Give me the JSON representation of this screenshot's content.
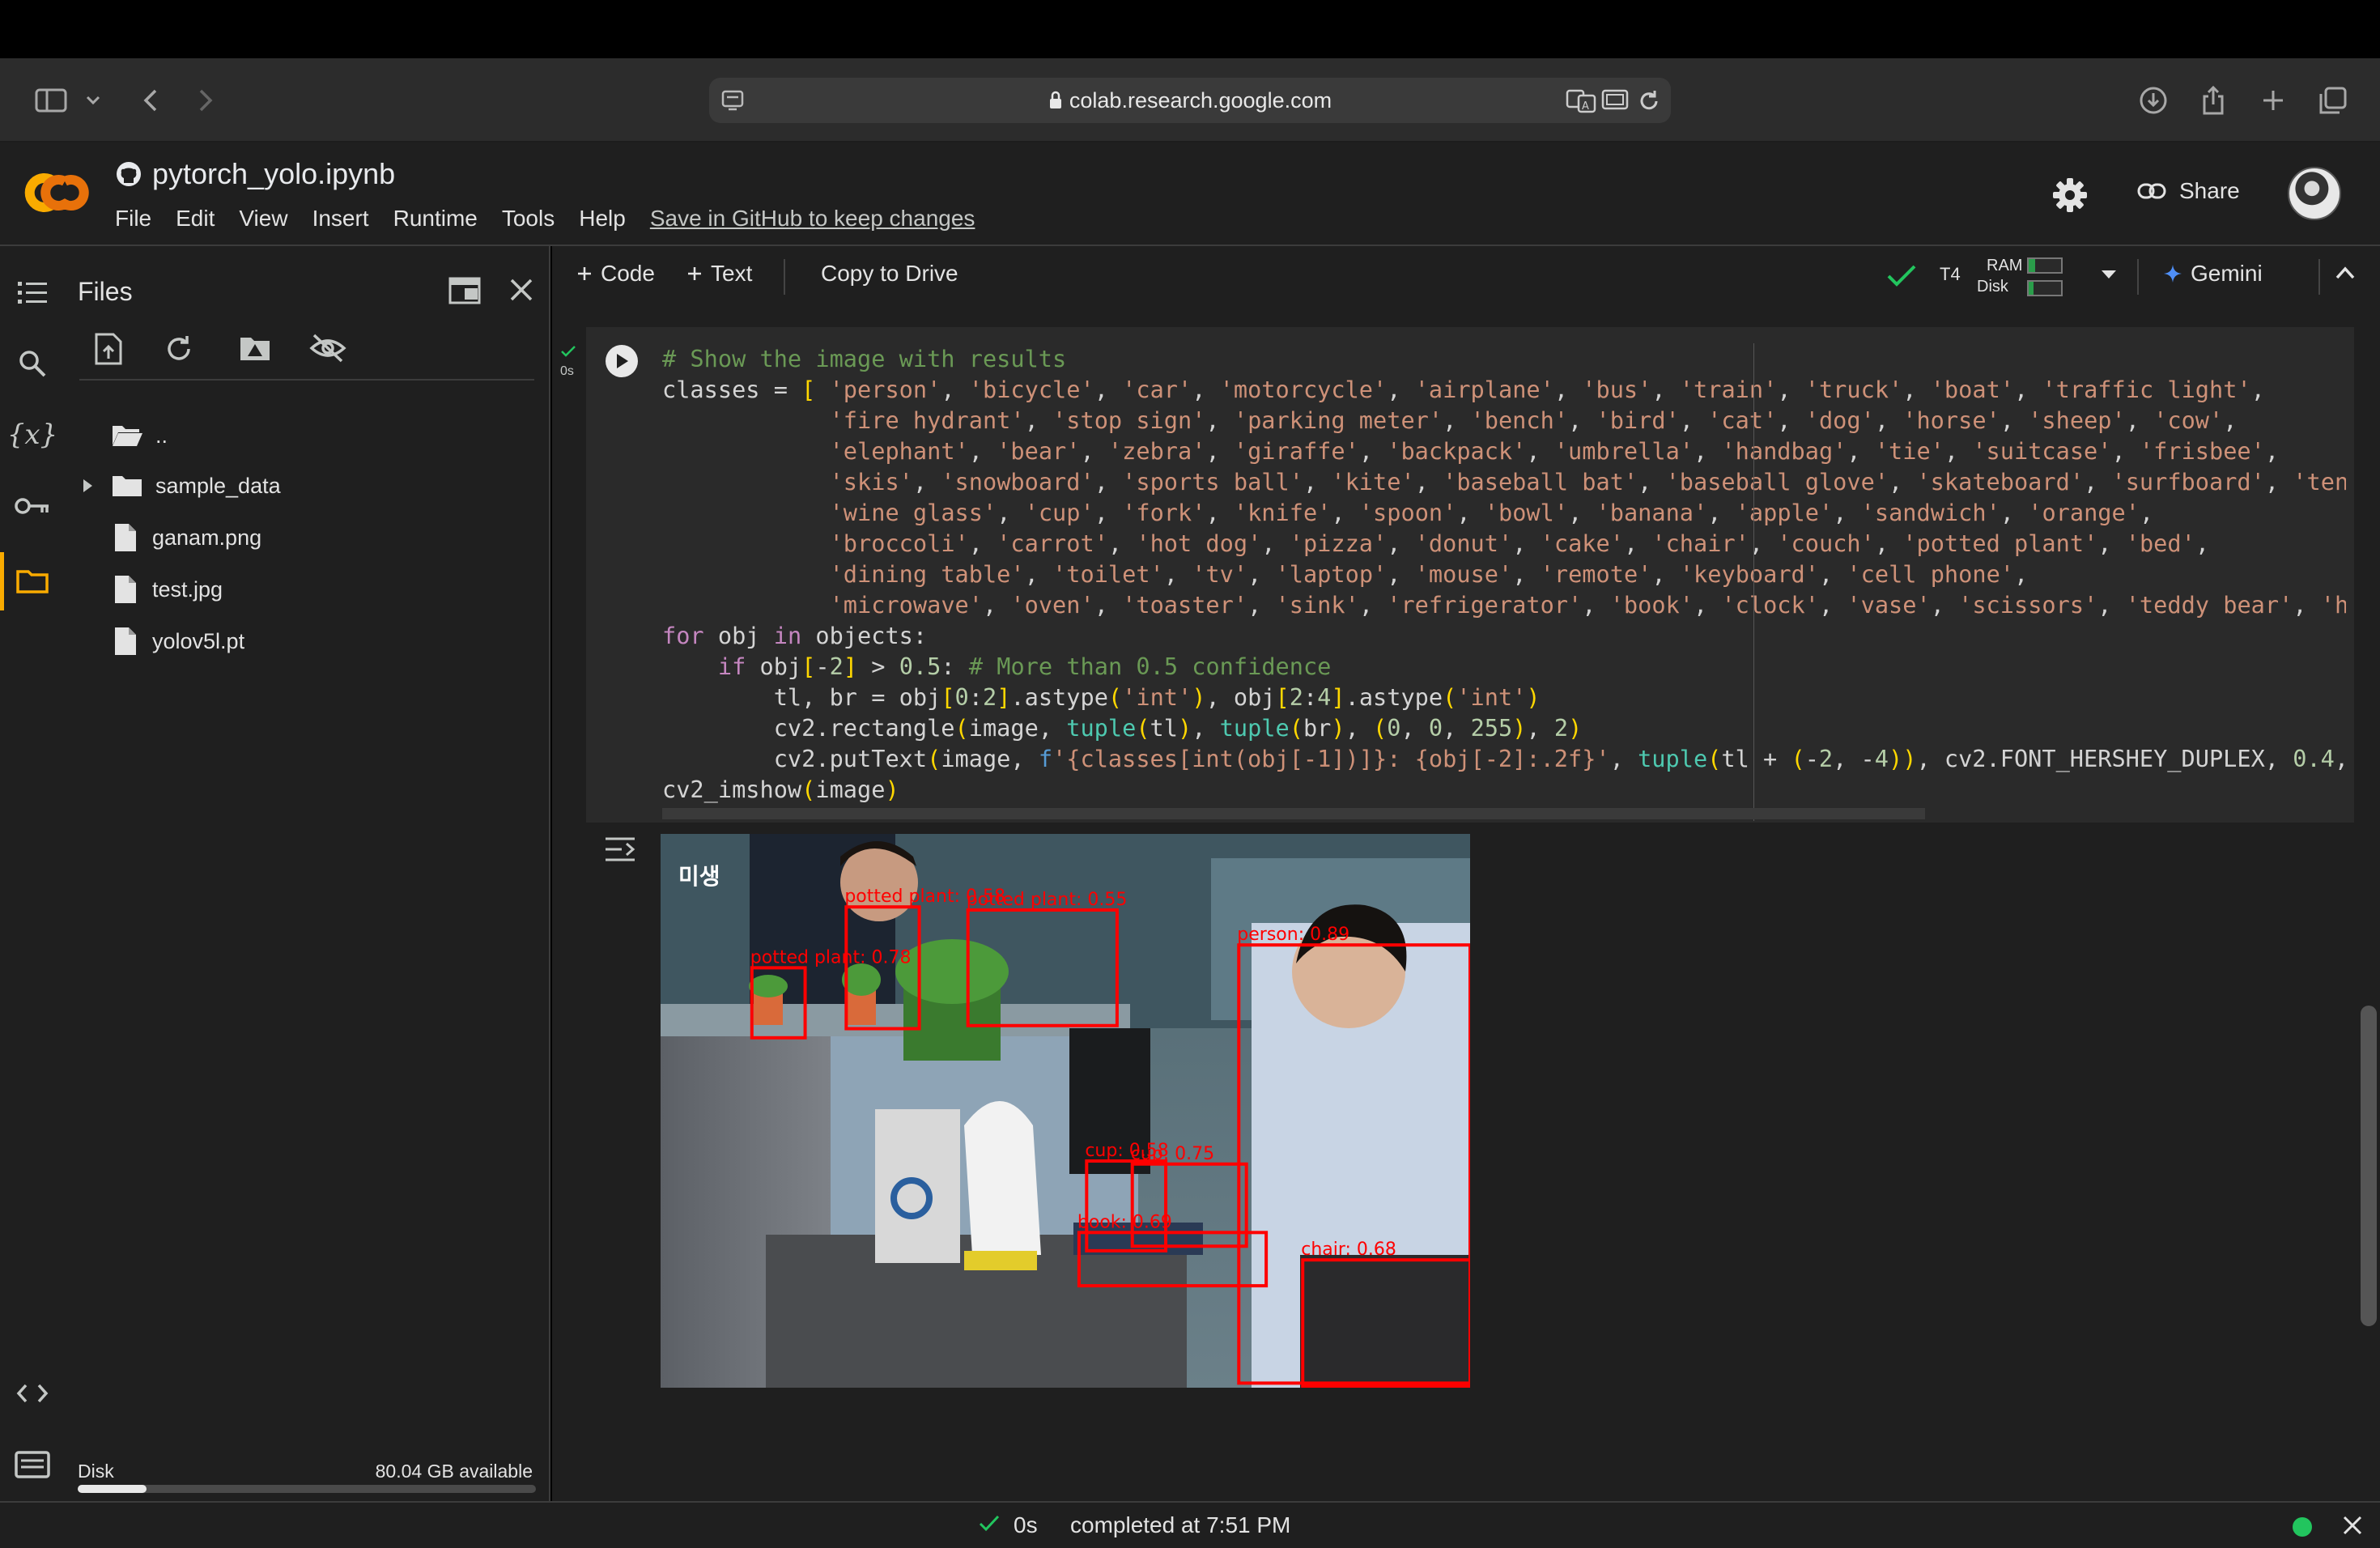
{
  "browser": {
    "url": "colab.research.google.com"
  },
  "header": {
    "notebook_title": "pytorch_yolo.ipynb",
    "menus": [
      "File",
      "Edit",
      "View",
      "Insert",
      "Runtime",
      "Tools",
      "Help"
    ],
    "save_link": "Save in GitHub to keep changes",
    "share_label": "Share"
  },
  "files_panel": {
    "title": "Files",
    "tree": [
      {
        "name": "..",
        "kind": "folder-open"
      },
      {
        "name": "sample_data",
        "kind": "folder"
      },
      {
        "name": "ganam.png",
        "kind": "file"
      },
      {
        "name": "test.jpg",
        "kind": "file"
      },
      {
        "name": "yolov5l.pt",
        "kind": "file"
      }
    ],
    "disk_label": "Disk",
    "disk_available": "80.04 GB available",
    "disk_used_fraction": 0.15
  },
  "toolbar": {
    "code_label": "Code",
    "text_label": "Text",
    "copy_to_drive": "Copy to Drive",
    "runtime": "T4",
    "ram_label": "RAM",
    "disk_label": "Disk",
    "gemini_label": "Gemini"
  },
  "cell": {
    "exec_time": "0s",
    "code_lines": [
      "# Show the image with results",
      "classes = [ 'person', 'bicycle', 'car', 'motorcycle', 'airplane', 'bus', 'train', 'truck', 'boat', 'traffic light',",
      "            'fire hydrant', 'stop sign', 'parking meter', 'bench', 'bird', 'cat', 'dog', 'horse', 'sheep', 'cow',",
      "            'elephant', 'bear', 'zebra', 'giraffe', 'backpack', 'umbrella', 'handbag', 'tie', 'suitcase', 'frisbee',",
      "            'skis', 'snowboard', 'sports ball', 'kite', 'baseball bat', 'baseball glove', 'skateboard', 'surfboard', 'tenni",
      "            'wine glass', 'cup', 'fork', 'knife', 'spoon', 'bowl', 'banana', 'apple', 'sandwich', 'orange',",
      "            'broccoli', 'carrot', 'hot dog', 'pizza', 'donut', 'cake', 'chair', 'couch', 'potted plant', 'bed',",
      "            'dining table', 'toilet', 'tv', 'laptop', 'mouse', 'remote', 'keyboard', 'cell phone',",
      "            'microwave', 'oven', 'toaster', 'sink', 'refrigerator', 'book', 'clock', 'vase', 'scissors', 'teddy bear', 'hai",
      "for obj in objects:",
      "    if obj[-2] > 0.5: # More than 0.5 confidence",
      "        tl, br = obj[0:2].astype('int'), obj[2:4].astype('int')",
      "        cv2.rectangle(image, tuple(tl), tuple(br), (0, 0, 255), 2)",
      "        cv2.putText(image, f'{classes[int(obj[-1])]}: {obj[-2]:.2f}', tuple(tl + (-2, -4)), cv2.FONT_HERSHEY_DUPLEX, 0.4, (",
      "cv2_imshow(image)"
    ]
  },
  "output": {
    "watermark": "미생",
    "detections": [
      {
        "label": "potted plant: 0.58"
      },
      {
        "label": "potted plant: 0.55"
      },
      {
        "label": "potted plant: 0.78"
      },
      {
        "label": "person: 0.89"
      },
      {
        "label": "cup: 0.58"
      },
      {
        "label": "cup: 0.75"
      },
      {
        "label": "book: 0.69"
      },
      {
        "label": "chair: 0.68"
      }
    ]
  },
  "status": {
    "time": "0s",
    "text": "completed at 7:51 PM"
  },
  "colors": {
    "accent_orange": "#f9ab00",
    "colab_red": "#e8710a",
    "box_red": "#ff0000",
    "ok_green": "#22c55e"
  }
}
